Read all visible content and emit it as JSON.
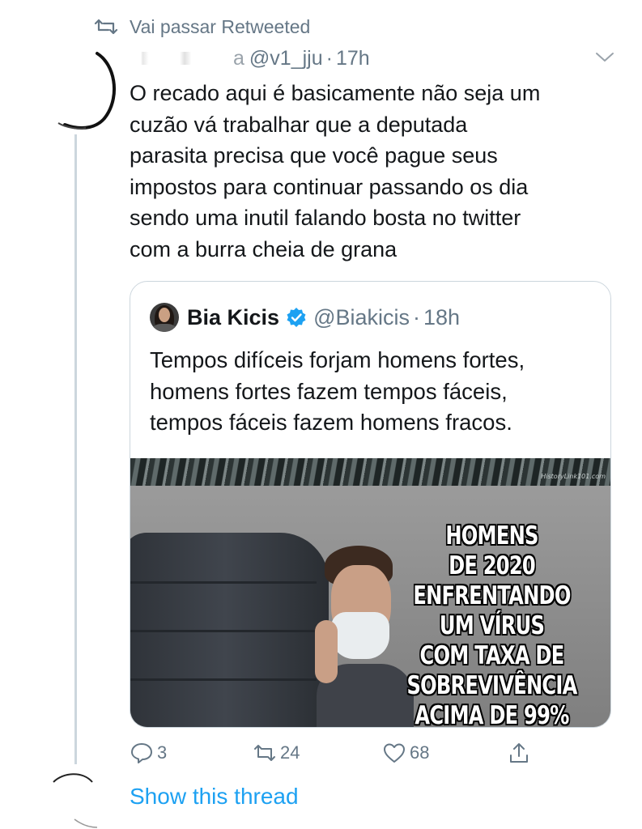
{
  "retweet_banner": {
    "label": "Vai passar Retweeted",
    "icon": "retweet-icon"
  },
  "tweet": {
    "handle": "@v1_jju",
    "name_tail": "a",
    "separator": "·",
    "time": "17h",
    "text_lines": [
      "O recado aqui é basicamente não seja um",
      "cuzão vá trabalhar que a deputada",
      "parasita precisa que você pague seus",
      "impostos para continuar passando os dia",
      "sendo uma inutil falando bosta no twitter",
      "com a burra cheia de grana"
    ]
  },
  "quote": {
    "name": "Bia Kicis",
    "handle": "@Biakicis",
    "separator": "·",
    "time": "18h",
    "text_lines": [
      "Tempos difíceis forjam homens fortes,",
      "homens fortes fazem tempos fáceis,",
      "tempos fáceis fazem homens fracos."
    ],
    "image": {
      "watermark": "HistoryLink101.com",
      "caption_lines": [
        "HOMENS",
        "DE 2020",
        "ENFRENTANDO",
        "UM VÍRUS",
        "COM TAXA DE",
        "SOBREVIVÊNCIA",
        "ACIMA DE 99%"
      ]
    }
  },
  "actions": {
    "reply_count": "3",
    "retweet_count": "24",
    "like_count": "68"
  },
  "show_thread": "Show this thread",
  "colors": {
    "accent": "#1da1f2",
    "secondary_text": "#657786",
    "primary_text": "#14171a",
    "border": "#ccd6dd"
  }
}
